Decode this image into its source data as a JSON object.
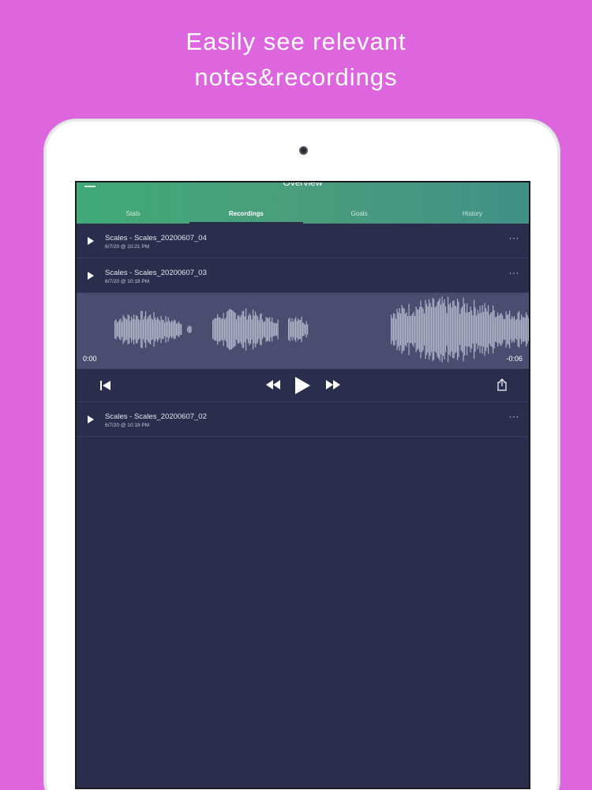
{
  "headline": {
    "line1": "Easily see relevant",
    "line2": "notes&recordings"
  },
  "app": {
    "nav_title": "Overview",
    "tabs": [
      {
        "label": "Stats",
        "active": false
      },
      {
        "label": "Recordings",
        "active": true
      },
      {
        "label": "Goals",
        "active": false
      },
      {
        "label": "History",
        "active": false
      }
    ],
    "recordings": [
      {
        "title": "Scales - Scales_20200607_04",
        "date": "6/7/20 @ 10:21 PM",
        "more": "···"
      },
      {
        "title": "Scales - Scales_20200607_03",
        "date": "6/7/20 @ 10:19 PM",
        "more": "···"
      },
      {
        "title": "Scales - Scales_20200607_02",
        "date": "6/7/20 @ 10:19 PM",
        "more": "···"
      }
    ],
    "player": {
      "time_start": "0:00",
      "time_end": "-0:06",
      "icons": [
        "skip-to-start-icon",
        "rewind-icon",
        "play-icon",
        "fast-forward-icon",
        "share-icon"
      ]
    }
  },
  "colors": {
    "background": "#dd66de",
    "header_gradient_start": "#3fa978",
    "header_gradient_end": "#3f9185",
    "list_background": "#2b2d4d",
    "waveform_background": "#4a4d6f",
    "waveform": "#aeb1c6"
  }
}
